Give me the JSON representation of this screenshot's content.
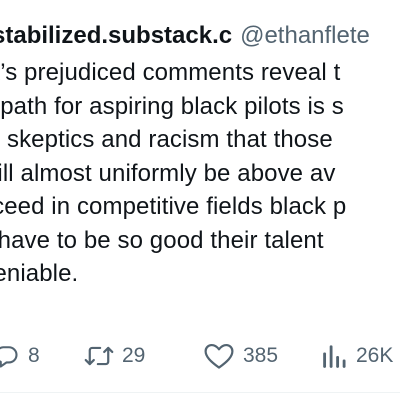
{
  "tweet": {
    "display_name": "stabilized.substack.c",
    "handle": "@ethanflete",
    "body_lines": [
      "rk’s prejudiced comments reveal t",
      "e path for aspiring black pilots is s",
      "th skeptics and racism that those",
      "will almost uniformly be above av",
      "cceed in competitive fields black p",
      "ll have to be so good their talent",
      "deniable."
    ],
    "actions": {
      "replies": "8",
      "retweets": "29",
      "likes": "385",
      "views": "26K"
    }
  },
  "icons": {
    "reply": "reply-icon",
    "retweet": "retweet-icon",
    "like": "heart-icon",
    "views": "views-chart-icon"
  },
  "colors": {
    "text": "#0f1419",
    "secondary": "#536471"
  }
}
